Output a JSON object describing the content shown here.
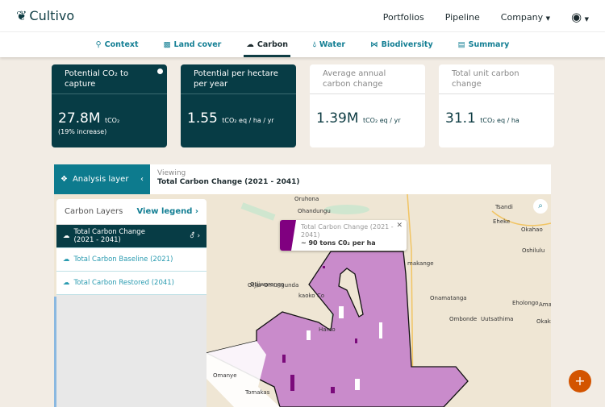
{
  "brand": "Cultivo",
  "nav": {
    "items": [
      "Portfolios",
      "Pipeline",
      "Company"
    ]
  },
  "tabs": [
    {
      "label": "Context",
      "icon": "map-pin-icon"
    },
    {
      "label": "Land cover",
      "icon": "landscape-icon"
    },
    {
      "label": "Carbon",
      "icon": "cloud-icon",
      "active": true
    },
    {
      "label": "Water",
      "icon": "water-drop-icon"
    },
    {
      "label": "Biodiversity",
      "icon": "butterfly-icon"
    },
    {
      "label": "Summary",
      "icon": "report-icon"
    }
  ],
  "cards": [
    {
      "title": "Potential CO₂ to capture",
      "value": "27.8M",
      "unit": "tCO₂",
      "sub": "(19% increase)"
    },
    {
      "title": "Potential per hectare per year",
      "value": "1.55",
      "unit": "tCO₂ eq / ha / yr"
    },
    {
      "title": "Average annual carbon change",
      "value": "1.39M",
      "unit": "tCO₂ eq / yr"
    },
    {
      "title": "Total unit carbon change",
      "value": "31.1",
      "unit": "tCO₂ eq / ha"
    }
  ],
  "analysis": {
    "label": "Analysis layer",
    "viewing_label": "Viewing",
    "viewing_value": "Total Carbon Change (2021 - 2041)"
  },
  "layers": {
    "title": "Carbon Layers",
    "legend_link": "View legend",
    "items": [
      "Total Carbon Change (2021 - 2041)",
      "Total Carbon Baseline (2021)",
      "Total Carbon Restored (2041)"
    ]
  },
  "popup": {
    "title": "Total Carbon Change (2021 - 2041)",
    "value": "~ 90 tons C0₂ per ha",
    "color": "#800080"
  },
  "map_labels": [
    "Oruhona",
    "Ohandungu",
    "wombe",
    "anga",
    "mbo",
    "Otjiwarongo",
    "Otjiu",
    "Omungunda",
    "kaoko Co",
    "Hamo",
    "Omanye",
    "Tomakas",
    "makange",
    "Onamatanga",
    "Ombonde",
    "Uutsathima",
    "Tsandi",
    "Eheke",
    "Okahao",
    "Oshilulu",
    "Eholongo",
    "Okake",
    "Amar"
  ],
  "colors": {
    "accent": "#0d7b8e",
    "dark": "#073c45",
    "fab": "#d35400"
  }
}
